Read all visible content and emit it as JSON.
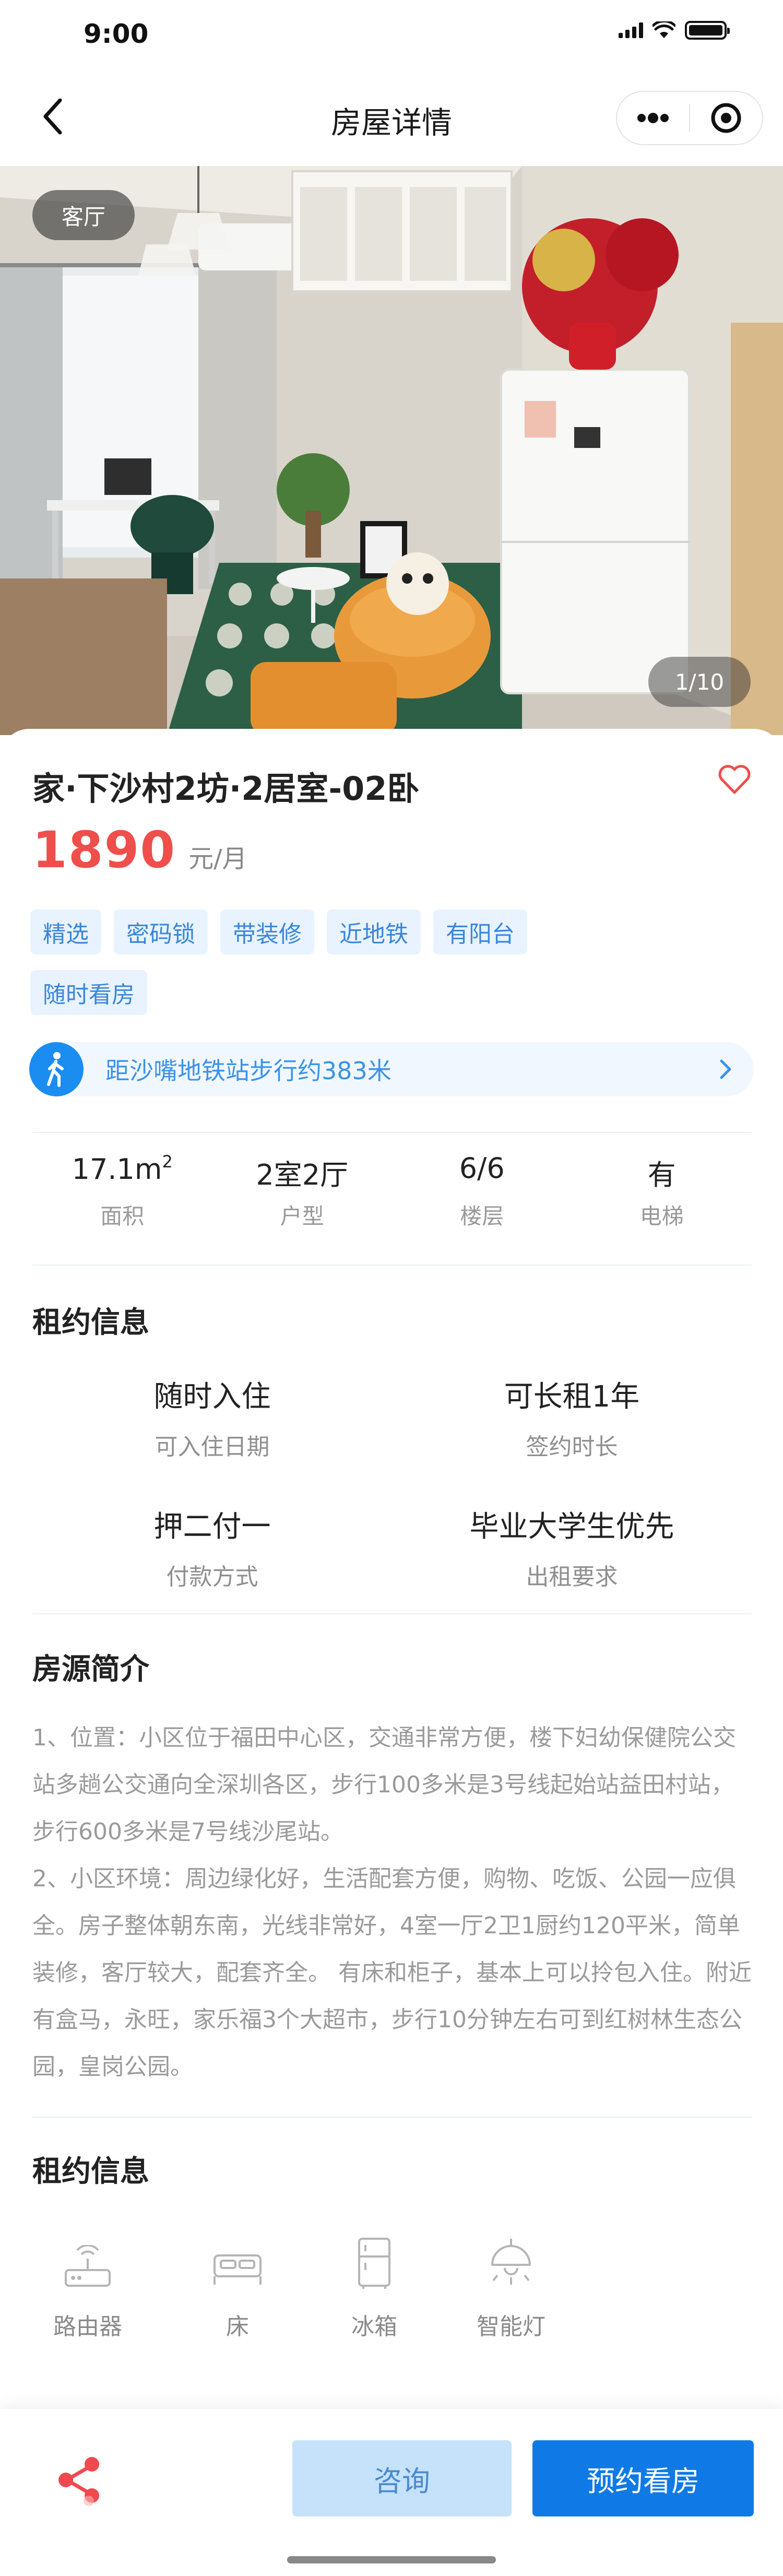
{
  "status_bar": {
    "time": "9:00"
  },
  "nav": {
    "title": "房屋详情",
    "back_icon": "chevron-left-icon",
    "more_icon": "more-dots-icon",
    "target_icon": "target-icon"
  },
  "photo": {
    "label": "客厅",
    "counter": "1/10"
  },
  "listing": {
    "title": "家·下沙村2坊·2居室-02卧",
    "price": "1890",
    "price_unit": "元/月",
    "tags": [
      "精选",
      "密码锁",
      "带装修",
      "近地铁",
      "有阳台",
      "随时看房"
    ],
    "metro_text": "距沙嘴地铁站步行约383米"
  },
  "stats": [
    {
      "value": "17.1m",
      "sup": "2",
      "label": "面积"
    },
    {
      "value": "2室2厅",
      "sup": "",
      "label": "户型"
    },
    {
      "value": "6/6",
      "sup": "",
      "label": "楼层"
    },
    {
      "value": "有",
      "sup": "",
      "label": "电梯"
    }
  ],
  "lease_info": {
    "title": "租约信息",
    "items": [
      {
        "value": "随时入住",
        "label": "可入住日期"
      },
      {
        "value": "可长租1年",
        "label": "签约时长"
      },
      {
        "value": "押二付一",
        "label": "付款方式"
      },
      {
        "value": "毕业大学生优先",
        "label": "出租要求"
      }
    ]
  },
  "description": {
    "title": "房源简介",
    "paragraphs": [
      "1、位置：小区位于福田中心区，交通非常方便，楼下妇幼保健院公交站多趟公交通向全深圳各区，步行100多米是3号线起始站益田村站，步行600多米是7号线沙尾站。",
      "2、小区环境：周边绿化好，生活配套方便，购物、吃饭、公园一应俱全。房子整体朝东南，光线非常好，4室一厅2卫1厨约120平米，简单装修，客厅较大，配套齐全。 有床和柜子，基本上可以拎包入住。附近有盒马，永旺，家乐福3个大超市，步行10分钟左右可到红树林生态公园，皇岗公园。"
    ]
  },
  "facilities": {
    "title": "租约信息",
    "items": [
      {
        "icon": "router-icon",
        "label": "路由器"
      },
      {
        "icon": "bed-icon",
        "label": "床"
      },
      {
        "icon": "fridge-icon",
        "label": "冰箱"
      },
      {
        "icon": "smart-lamp-icon",
        "label": "智能灯"
      }
    ]
  },
  "bottom_bar": {
    "share_icon": "share-icon",
    "consult": "咨询",
    "book": "预约看房"
  },
  "colors": {
    "accent": "#0f7ae5",
    "price": "#ef4e4b",
    "tag_bg": "#e8f3ff",
    "tag_text": "#3a86d8"
  }
}
